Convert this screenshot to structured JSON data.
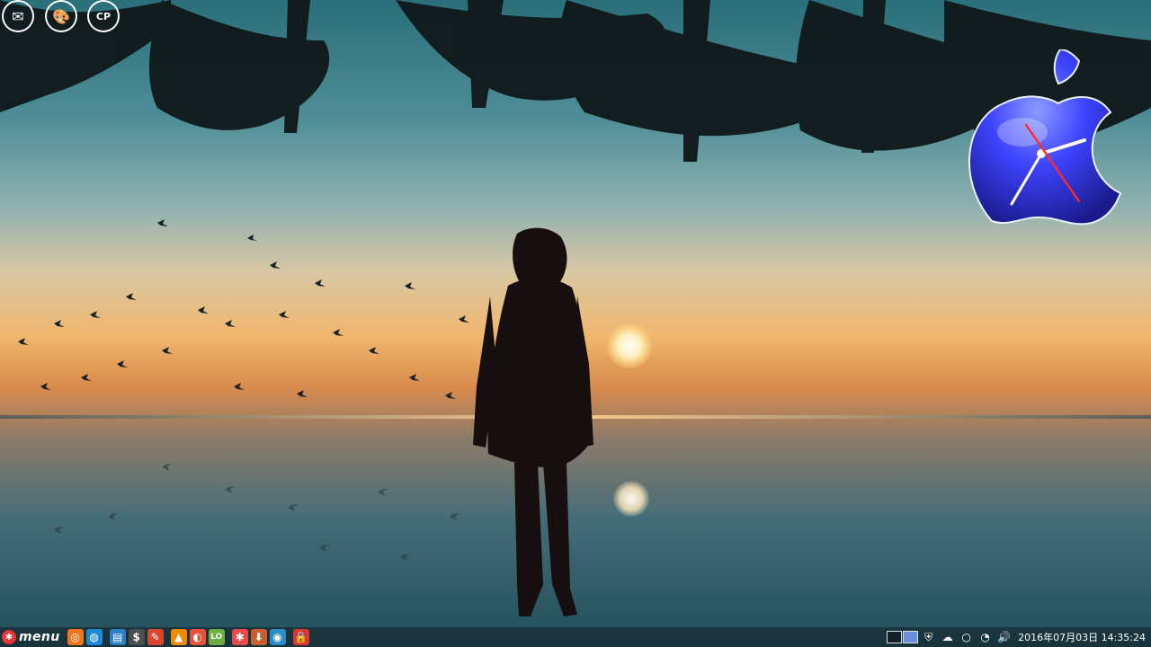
{
  "desktop_icons": [
    {
      "name": "mail-icon",
      "glyph": "✉",
      "color": "#d42f2f"
    },
    {
      "name": "paint-palette-icon",
      "glyph": "🎨",
      "color": "#a84fd8"
    },
    {
      "name": "control-panel-icon",
      "glyph": "CP",
      "color": "#2f71c9"
    }
  ],
  "clock_widget": {
    "brand_icon": "apple-logo-icon",
    "color": "#4a52ff"
  },
  "taskbar": {
    "menu_label": "menu",
    "launchers": [
      {
        "name": "firefox-icon",
        "glyph": "◎",
        "color": "#f2761b"
      },
      {
        "name": "network-browser-icon",
        "glyph": "◍",
        "color": "#1f88d3"
      },
      {
        "name": "file-manager-icon",
        "glyph": "▤",
        "color": "#2f7fc7"
      },
      {
        "name": "terminal-icon",
        "glyph": "$",
        "color": "#4d4d4d"
      },
      {
        "name": "text-editor-icon",
        "glyph": "✎",
        "color": "#d9462f"
      },
      {
        "name": "media-player-icon",
        "glyph": "▲",
        "color": "#f08a00"
      },
      {
        "name": "package-manager-icon",
        "glyph": "◐",
        "color": "#e6513c"
      },
      {
        "name": "libreoffice-icon",
        "glyph": "LO",
        "color": "#6cae3f"
      },
      {
        "name": "help-icon",
        "glyph": "✱",
        "color": "#e84b4b"
      },
      {
        "name": "download-icon",
        "glyph": "⬇",
        "color": "#c95e2f"
      },
      {
        "name": "settings-icon",
        "glyph": "◉",
        "color": "#2b8cc6"
      },
      {
        "name": "lock-icon",
        "glyph": "🔒",
        "color": "#d93636"
      }
    ],
    "tray": {
      "security_icon": "shield-icon",
      "weather_icon": "cloud-icon",
      "power_icon": "power-icon",
      "network_icon": "wifi-icon",
      "volume_icon": "volume-icon"
    },
    "clock_text": "2016年07月03日 14:35:24"
  }
}
